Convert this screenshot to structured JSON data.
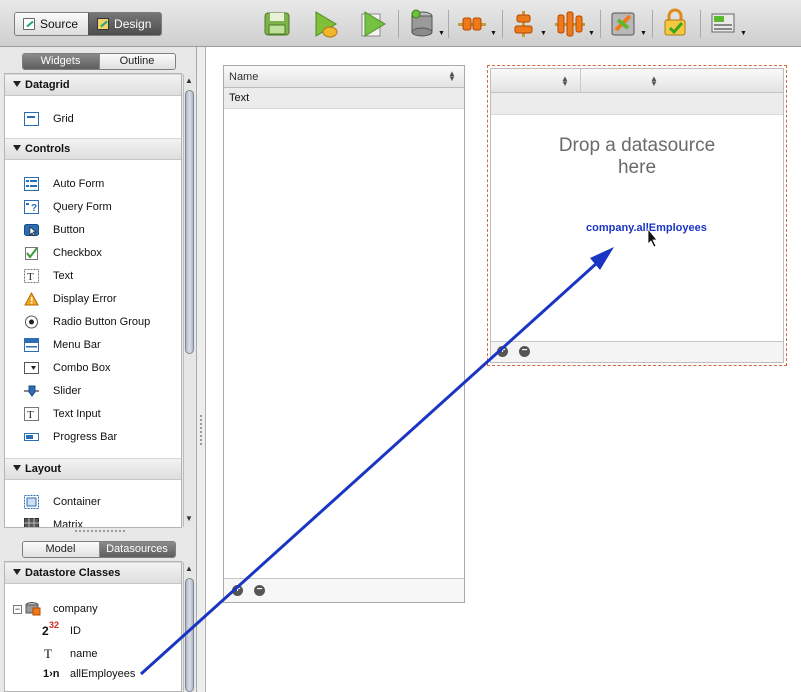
{
  "toolbar": {
    "mode_tabs": [
      {
        "label": "Source",
        "active": false
      },
      {
        "label": "Design",
        "active": true
      }
    ],
    "icons": [
      "save-icon",
      "run-icon",
      "run-file-icon",
      "datastore-icon",
      "connect-icon",
      "align-icon",
      "distribute-icon",
      "sync-icon",
      "lock-icon",
      "layout-icon"
    ]
  },
  "widgets_panel": {
    "tabs": [
      "Widgets",
      "Outline"
    ],
    "sections": [
      {
        "title": "Datagrid",
        "items": [
          "Grid"
        ]
      },
      {
        "title": "Controls",
        "items": [
          "Auto Form",
          "Query Form",
          "Button",
          "Checkbox",
          "Text",
          "Display Error",
          "Radio Button Group",
          "Menu Bar",
          "Combo Box",
          "Slider",
          "Text Input",
          "Progress Bar"
        ]
      },
      {
        "title": "Layout",
        "items": [
          "Container",
          "Matrix"
        ]
      }
    ]
  },
  "model_panel": {
    "tabs": [
      "Model",
      "Datasources"
    ],
    "section_title": "Datastore Classes",
    "class_name": "company",
    "attributes": [
      {
        "type_glyph": "2",
        "type_sup": "32",
        "name": "ID"
      },
      {
        "type_glyph": "T",
        "type_sup": "",
        "name": "name"
      },
      {
        "type_glyph": "1›n",
        "type_sup": "",
        "name": "allEmployees"
      }
    ]
  },
  "grid1": {
    "column": "Name",
    "rows": [
      "Text"
    ]
  },
  "grid2": {
    "drop_hint_line1": "Drop a datasource",
    "drop_hint_line2": "here",
    "drag_label": "company.allEmployees"
  },
  "colors": {
    "accent_blue": "#1a35c2",
    "selection_dash": "#d66a3a"
  }
}
